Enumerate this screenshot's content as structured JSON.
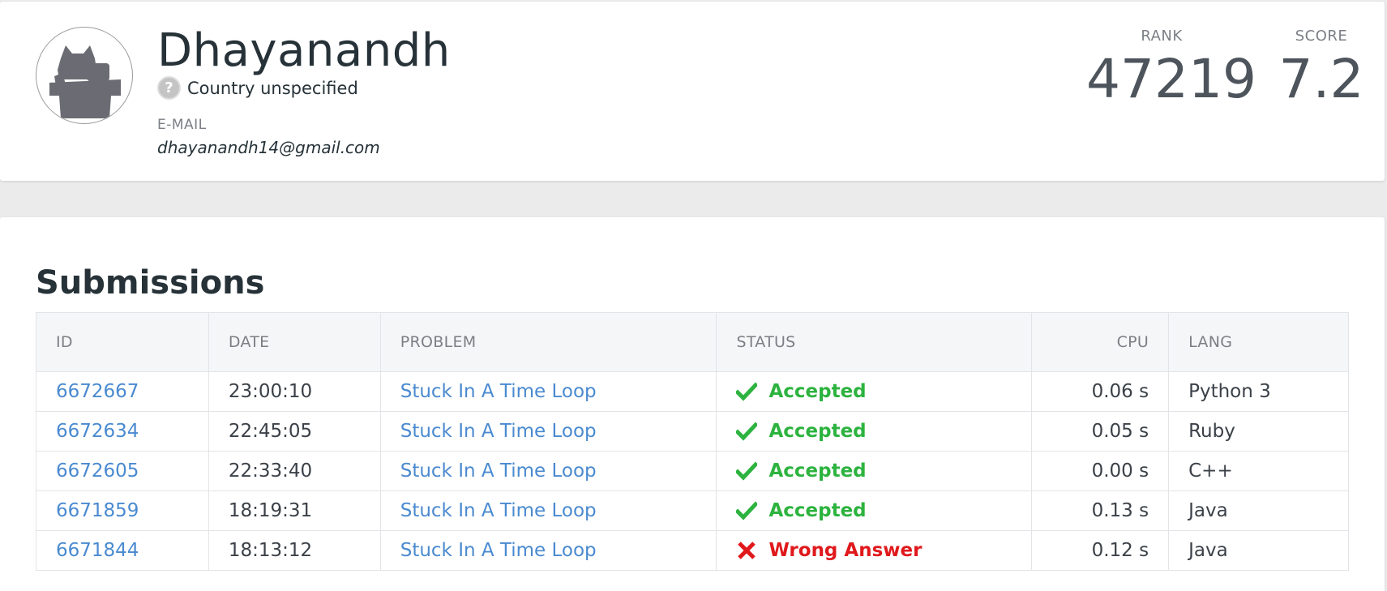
{
  "profile": {
    "name": "Dhayanandh",
    "country": "Country unspecified",
    "email_label": "E-MAIL",
    "email": "dhayanandh14@gmail.com",
    "rank_label": "RANK",
    "rank": "47219",
    "score_label": "SCORE",
    "score": "7.2"
  },
  "submissions": {
    "title": "Submissions",
    "columns": [
      "ID",
      "DATE",
      "PROBLEM",
      "STATUS",
      "CPU",
      "LANG"
    ],
    "rows": [
      {
        "id": "6672667",
        "date": "23:00:10",
        "problem": "Stuck In A Time Loop",
        "status": "Accepted",
        "status_icon": "check-icon",
        "cpu": "0.06 s",
        "lang": "Python 3"
      },
      {
        "id": "6672634",
        "date": "22:45:05",
        "problem": "Stuck In A Time Loop",
        "status": "Accepted",
        "status_icon": "check-icon",
        "cpu": "0.05 s",
        "lang": "Ruby"
      },
      {
        "id": "6672605",
        "date": "22:33:40",
        "problem": "Stuck In A Time Loop",
        "status": "Accepted",
        "status_icon": "check-icon",
        "cpu": "0.00 s",
        "lang": "C++"
      },
      {
        "id": "6671859",
        "date": "18:19:31",
        "problem": "Stuck In A Time Loop",
        "status": "Accepted",
        "status_icon": "check-icon",
        "cpu": "0.13 s",
        "lang": "Java"
      },
      {
        "id": "6671844",
        "date": "18:13:12",
        "problem": "Stuck In A Time Loop",
        "status": "Wrong Answer",
        "status_icon": "cross-icon",
        "cpu": "0.12 s",
        "lang": "Java"
      }
    ]
  },
  "colors": {
    "accepted": "#2db33f",
    "wrong": "#e0191c",
    "link": "#4a8ad0"
  }
}
